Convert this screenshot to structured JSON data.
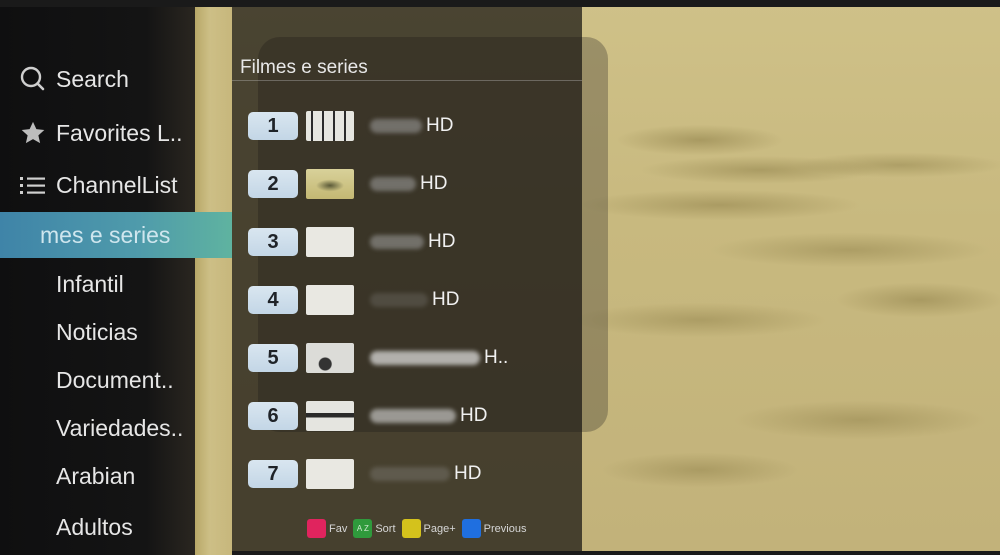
{
  "sidebar": {
    "search_label": "Search",
    "favorites_label": "Favorites L..",
    "channellist_label": "ChannelList",
    "categories": [
      {
        "label": "mes e series",
        "selected": true
      },
      {
        "label": "Infantil",
        "selected": false
      },
      {
        "label": "Noticias",
        "selected": false
      },
      {
        "label": "Document..",
        "selected": false
      },
      {
        "label": "Variedades..",
        "selected": false
      },
      {
        "label": "Arabian",
        "selected": false
      },
      {
        "label": "Adultos",
        "selected": false
      }
    ]
  },
  "panel": {
    "title": "Filmes e series",
    "channels": [
      {
        "number": "1",
        "name_suffix": "HD"
      },
      {
        "number": "2",
        "name_suffix": "HD"
      },
      {
        "number": "3",
        "name_suffix": "HD"
      },
      {
        "number": "4",
        "name_suffix": "HD"
      },
      {
        "number": "5",
        "name_suffix": "H.."
      },
      {
        "number": "6",
        "name_suffix": "HD"
      },
      {
        "number": "7",
        "name_suffix": "HD"
      }
    ]
  },
  "legend": {
    "items": [
      {
        "label": "Fav",
        "color": "#e0245e"
      },
      {
        "label": "Sort",
        "color": "#2f9a3c",
        "glyph": "A Z"
      },
      {
        "label": "Page+",
        "color": "#d4c21c"
      },
      {
        "label": "Previous",
        "color": "#1f6fe0"
      }
    ]
  }
}
